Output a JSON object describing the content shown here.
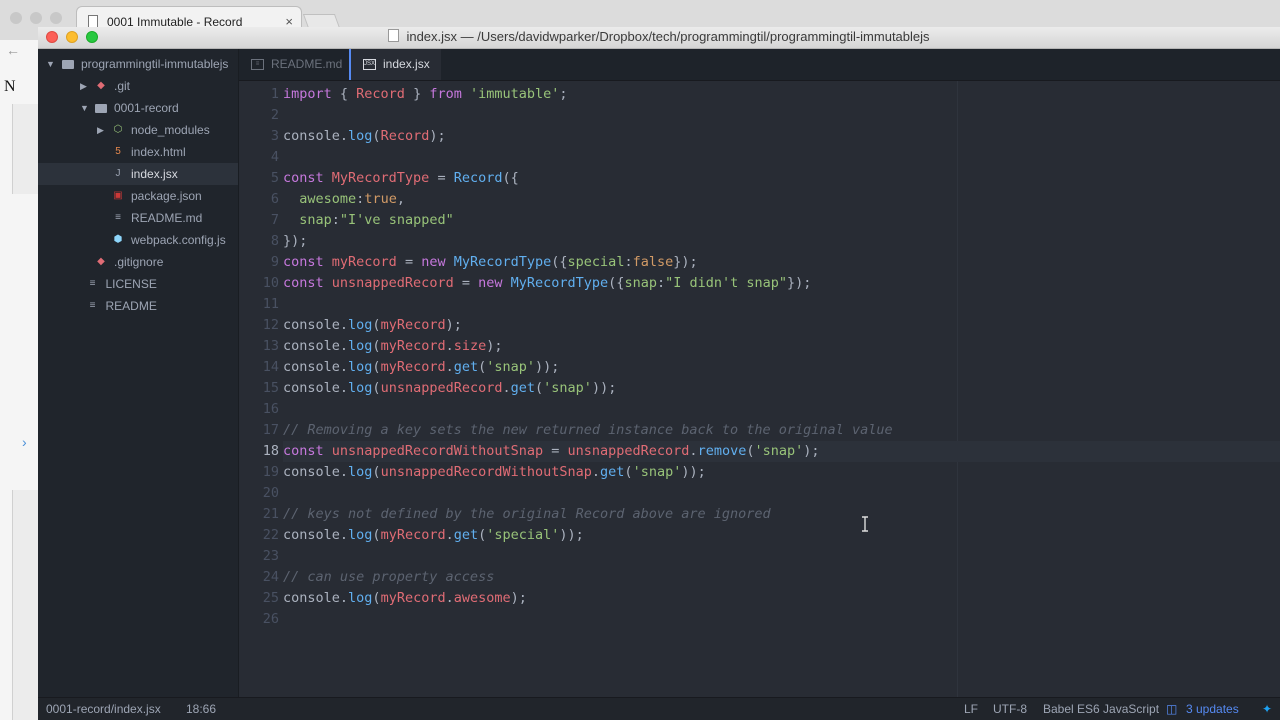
{
  "browser": {
    "tab_title": "0001 Immutable - Record",
    "close_glyph": "×",
    "back_glyph": "←",
    "forward_glyph": "›",
    "page_letters": "N"
  },
  "window": {
    "title": "index.jsx — /Users/davidwparker/Dropbox/tech/programmingtil/programmingtil-immutablejs"
  },
  "sidebar": {
    "root": "programmingtil-immutablejs",
    "items": [
      {
        "label": ".git",
        "icon": "git-icon"
      },
      {
        "label": "0001-record",
        "icon": "folder-icon"
      },
      {
        "label": "node_modules",
        "icon": "package-icon"
      },
      {
        "label": "index.html",
        "icon": "html5-icon"
      },
      {
        "label": "index.jsx",
        "icon": "jsx-icon"
      },
      {
        "label": "package.json",
        "icon": "npm-icon"
      },
      {
        "label": "README.md",
        "icon": "book-icon"
      },
      {
        "label": "webpack.config.js",
        "icon": "webpack-icon"
      },
      {
        "label": ".gitignore",
        "icon": "git-icon"
      },
      {
        "label": "LICENSE",
        "icon": "book-icon"
      },
      {
        "label": "README",
        "icon": "book-icon"
      }
    ]
  },
  "tabs": [
    {
      "label": "README.md",
      "icon": "book-icon"
    },
    {
      "label": "index.jsx",
      "icon": "jsx-icon"
    }
  ],
  "editor": {
    "current_line": 18,
    "lines": [
      [
        [
          "kw",
          "import"
        ],
        [
          "p",
          " { "
        ],
        [
          "var",
          "Record"
        ],
        [
          "p",
          " } "
        ],
        [
          "kw",
          "from"
        ],
        [
          "p",
          " "
        ],
        [
          "str",
          "'immutable'"
        ],
        [
          "p",
          ";"
        ]
      ],
      [],
      [
        [
          "p",
          "console."
        ],
        [
          "fn",
          "log"
        ],
        [
          "p",
          "("
        ],
        [
          "var",
          "Record"
        ],
        [
          "p",
          ");"
        ]
      ],
      [],
      [
        [
          "kw",
          "const"
        ],
        [
          "p",
          " "
        ],
        [
          "var",
          "MyRecordType"
        ],
        [
          "p",
          " = "
        ],
        [
          "fn",
          "Record"
        ],
        [
          "p",
          "({"
        ]
      ],
      [
        [
          "p",
          "  "
        ],
        [
          "str",
          "awesome"
        ],
        [
          "p",
          ":"
        ],
        [
          "num",
          "true"
        ],
        [
          "p",
          ","
        ]
      ],
      [
        [
          "p",
          "  "
        ],
        [
          "str",
          "snap"
        ],
        [
          "p",
          ":"
        ],
        [
          "str",
          "\"I've snapped\""
        ]
      ],
      [
        [
          "p",
          "});"
        ]
      ],
      [
        [
          "kw",
          "const"
        ],
        [
          "p",
          " "
        ],
        [
          "var",
          "myRecord"
        ],
        [
          "p",
          " = "
        ],
        [
          "kw",
          "new"
        ],
        [
          "p",
          " "
        ],
        [
          "fn",
          "MyRecordType"
        ],
        [
          "p",
          "({"
        ],
        [
          "str",
          "special"
        ],
        [
          "p",
          ":"
        ],
        [
          "num",
          "false"
        ],
        [
          "p",
          "});"
        ]
      ],
      [
        [
          "kw",
          "const"
        ],
        [
          "p",
          " "
        ],
        [
          "var",
          "unsnappedRecord"
        ],
        [
          "p",
          " = "
        ],
        [
          "kw",
          "new"
        ],
        [
          "p",
          " "
        ],
        [
          "fn",
          "MyRecordType"
        ],
        [
          "p",
          "({"
        ],
        [
          "str",
          "snap"
        ],
        [
          "p",
          ":"
        ],
        [
          "str",
          "\"I didn't snap\""
        ],
        [
          "p",
          "});"
        ]
      ],
      [],
      [
        [
          "p",
          "console."
        ],
        [
          "fn",
          "log"
        ],
        [
          "p",
          "("
        ],
        [
          "var",
          "myRecord"
        ],
        [
          "p",
          ");"
        ]
      ],
      [
        [
          "p",
          "console."
        ],
        [
          "fn",
          "log"
        ],
        [
          "p",
          "("
        ],
        [
          "var",
          "myRecord"
        ],
        [
          "p",
          "."
        ],
        [
          "var",
          "size"
        ],
        [
          "p",
          ");"
        ]
      ],
      [
        [
          "p",
          "console."
        ],
        [
          "fn",
          "log"
        ],
        [
          "p",
          "("
        ],
        [
          "var",
          "myRecord"
        ],
        [
          "p",
          "."
        ],
        [
          "fn",
          "get"
        ],
        [
          "p",
          "("
        ],
        [
          "str",
          "'snap'"
        ],
        [
          "p",
          "));"
        ]
      ],
      [
        [
          "p",
          "console."
        ],
        [
          "fn",
          "log"
        ],
        [
          "p",
          "("
        ],
        [
          "var",
          "unsnappedRecord"
        ],
        [
          "p",
          "."
        ],
        [
          "fn",
          "get"
        ],
        [
          "p",
          "("
        ],
        [
          "str",
          "'snap'"
        ],
        [
          "p",
          "));"
        ]
      ],
      [],
      [
        [
          "cm",
          "// Removing a key sets the new returned instance back to the original value"
        ]
      ],
      [
        [
          "kw",
          "const"
        ],
        [
          "p",
          " "
        ],
        [
          "var",
          "unsnappedRecordWithoutSnap"
        ],
        [
          "p",
          " = "
        ],
        [
          "var",
          "unsnappedRecord"
        ],
        [
          "p",
          "."
        ],
        [
          "fn",
          "remove"
        ],
        [
          "p",
          "("
        ],
        [
          "str",
          "'snap'"
        ],
        [
          "p",
          ");"
        ]
      ],
      [
        [
          "p",
          "console."
        ],
        [
          "fn",
          "log"
        ],
        [
          "p",
          "("
        ],
        [
          "var",
          "unsnappedRecordWithoutSnap"
        ],
        [
          "p",
          "."
        ],
        [
          "fn",
          "get"
        ],
        [
          "p",
          "("
        ],
        [
          "str",
          "'snap'"
        ],
        [
          "p",
          "));"
        ]
      ],
      [],
      [
        [
          "cm",
          "// keys not defined by the original Record above are ignored"
        ]
      ],
      [
        [
          "p",
          "console."
        ],
        [
          "fn",
          "log"
        ],
        [
          "p",
          "("
        ],
        [
          "var",
          "myRecord"
        ],
        [
          "p",
          "."
        ],
        [
          "fn",
          "get"
        ],
        [
          "p",
          "("
        ],
        [
          "str",
          "'special'"
        ],
        [
          "p",
          "));"
        ]
      ],
      [],
      [
        [
          "cm",
          "// can use property access"
        ]
      ],
      [
        [
          "p",
          "console."
        ],
        [
          "fn",
          "log"
        ],
        [
          "p",
          "("
        ],
        [
          "var",
          "myRecord"
        ],
        [
          "p",
          "."
        ],
        [
          "var",
          "awesome"
        ],
        [
          "p",
          ");"
        ]
      ],
      []
    ]
  },
  "status": {
    "path": "0001-record/index.jsx",
    "position": "18:66",
    "line_ending": "LF",
    "encoding": "UTF-8",
    "grammar": "Babel ES6 JavaScript",
    "updates": "3 updates"
  },
  "colors": {
    "keyword": "#c678dd",
    "variable": "#e06c75",
    "function": "#61afef",
    "string": "#98c379",
    "number": "#d19a66",
    "comment": "#5c6370",
    "accent": "#568af2"
  }
}
